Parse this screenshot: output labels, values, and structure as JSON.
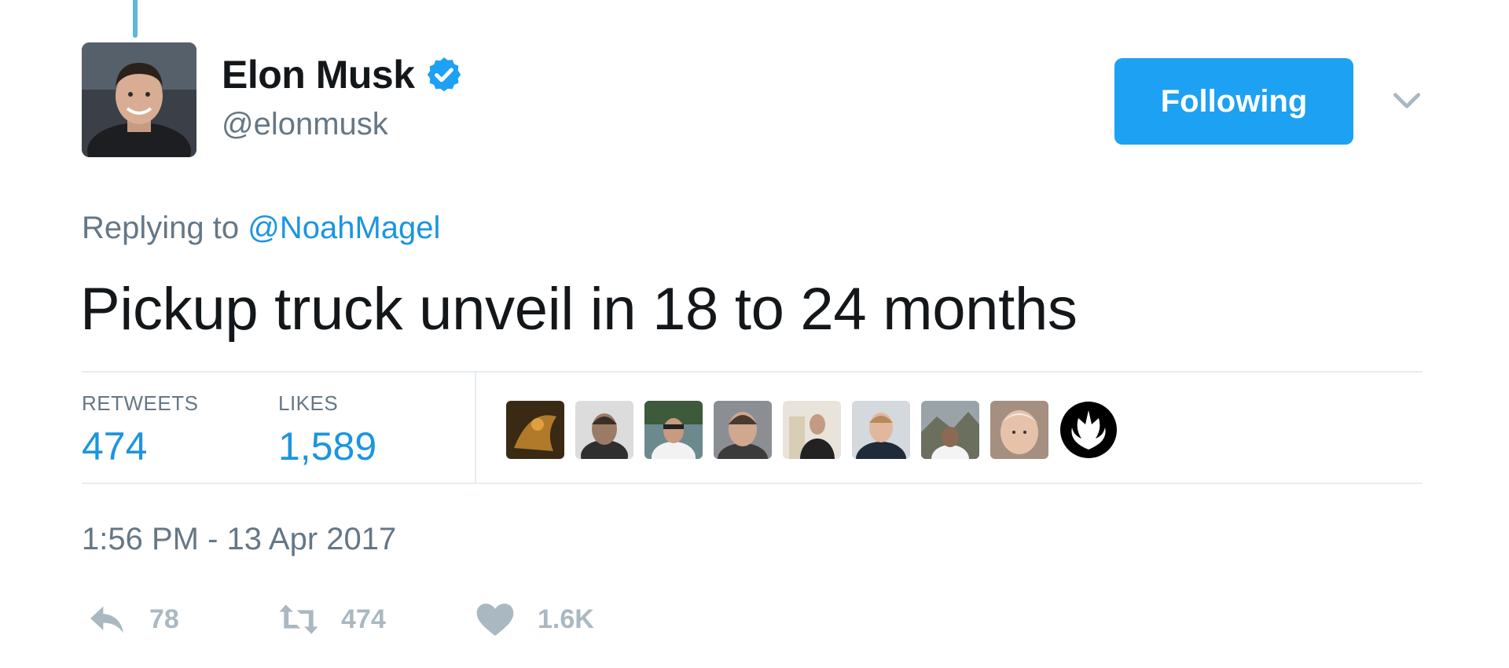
{
  "author": {
    "name": "Elon Musk",
    "handle": "@elonmusk",
    "verified_icon": "verified-badge-icon",
    "avatar_icon": "avatar"
  },
  "follow_button": {
    "label": "Following"
  },
  "menu": {
    "icon": "chevron-down-icon"
  },
  "reply": {
    "prefix": "Replying to",
    "target": "@NoahMagel"
  },
  "tweet": {
    "text": "Pickup truck unveil in 18 to 24 months"
  },
  "stats": {
    "retweets_label": "RETWEETS",
    "retweets_value": "474",
    "likes_label": "LIKES",
    "likes_value": "1,589"
  },
  "timestamp": "1:56 PM - 13 Apr 2017",
  "actions": {
    "reply_count": "78",
    "retweet_count": "474",
    "like_count": "1.6K"
  },
  "colors": {
    "accent": "#1da1f2",
    "link": "#1b95e0",
    "muted": "#657786",
    "icon_gray": "#aab8c2",
    "border": "#e6ecf0"
  }
}
